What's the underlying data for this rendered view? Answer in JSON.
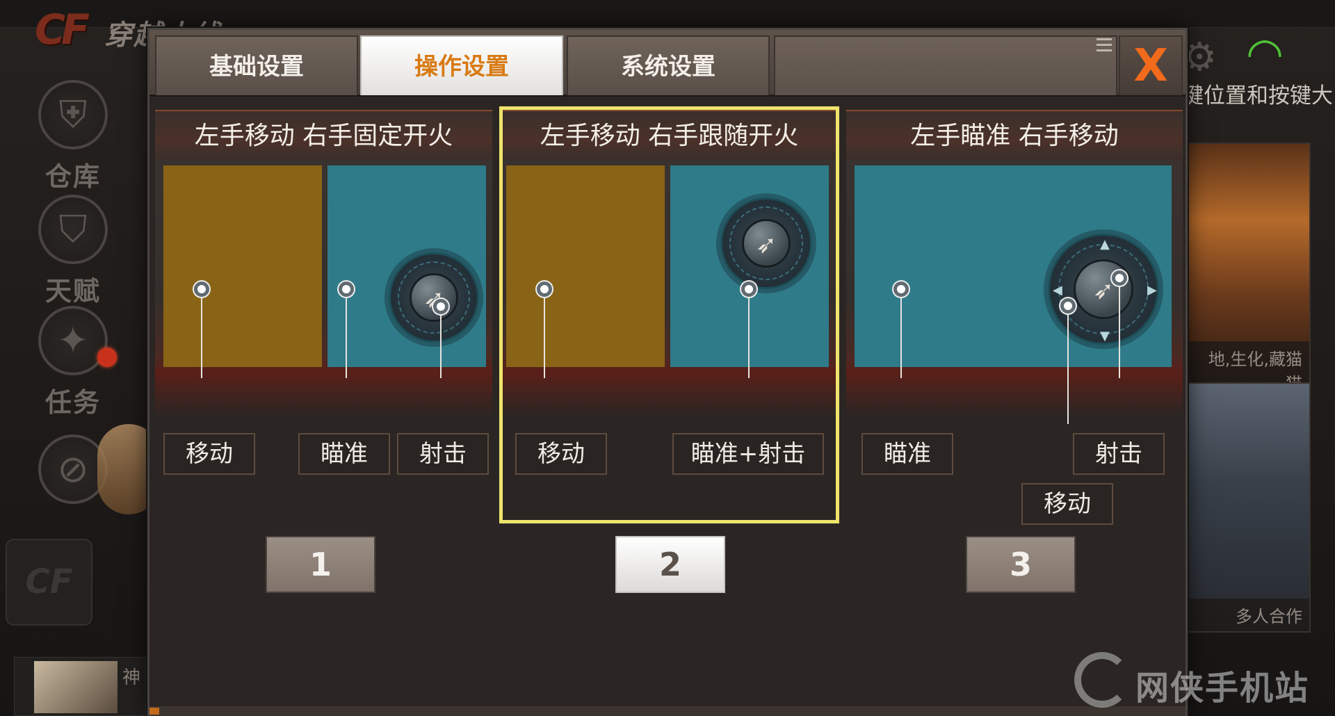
{
  "background": {
    "logo_text": "CF",
    "logo_title": "穿越火线",
    "sidebar_items": [
      {
        "label": "仓库",
        "icon": "warehouse-icon",
        "glyph": "⛨"
      },
      {
        "label": "天赋",
        "icon": "talent-icon",
        "glyph": "⛉"
      },
      {
        "label": "任务",
        "icon": "mission-icon",
        "glyph": "✦"
      },
      {
        "label": "",
        "icon": "compass-icon",
        "glyph": "⊘"
      }
    ],
    "side_box_text": "CF",
    "bottom_card_name": "神",
    "gear_glyph": "⚙",
    "wifi_glyph": "◠",
    "hint_text": "键位置和按键大",
    "card1_caption": "地,生化,藏猫猫",
    "card2_caption": "多人合作",
    "watermark": "网侠手机站",
    "colors": {
      "wifi": "#4ec038",
      "alert_dot": "#c8321c"
    }
  },
  "dialog": {
    "tabs": [
      {
        "label": "基础设置",
        "active": false
      },
      {
        "label": "操作设置",
        "active": true
      },
      {
        "label": "系统设置",
        "active": false
      }
    ],
    "close_glyph": "X",
    "accent_color": "#f26a1b",
    "selected_frame_color": "#efe46d"
  },
  "modes": [
    {
      "title": "左手移动 右手固定开火",
      "labels": [
        "移动",
        "瞄准",
        "射击"
      ],
      "button": "1",
      "selected": false
    },
    {
      "title": "左手移动 右手跟随开火",
      "labels": [
        "移动",
        "瞄准+射击"
      ],
      "button": "2",
      "selected": true
    },
    {
      "title": "左手瞄准 右手移动",
      "labels": [
        "瞄准",
        "射击",
        "移动"
      ],
      "button": "3",
      "selected": false
    }
  ],
  "zone_colors": {
    "move": "#8a6416",
    "aim": "#2f7b89"
  },
  "bullet_glyph": "➶"
}
